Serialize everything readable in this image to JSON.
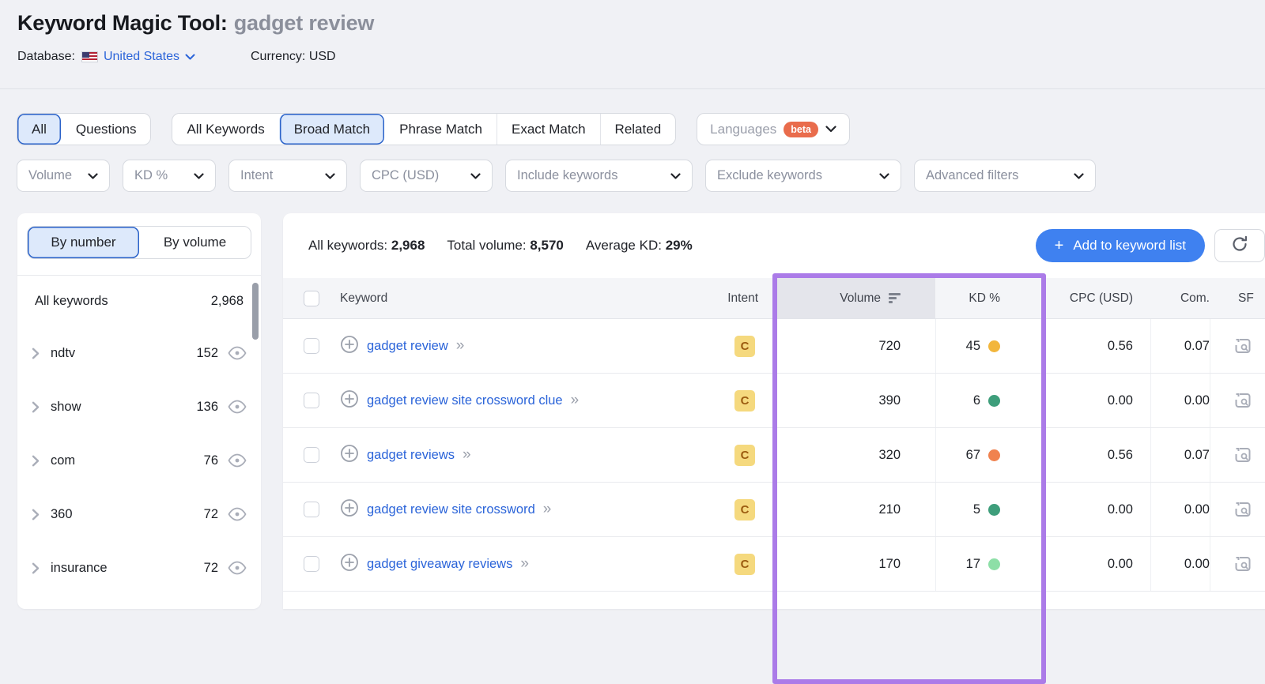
{
  "header": {
    "title": "Keyword Magic Tool:",
    "query": "gadget review",
    "database_label": "Database:",
    "database_value": "United States",
    "currency_label": "Currency:",
    "currency_value": "USD"
  },
  "tabs": {
    "group1": [
      {
        "label": "All",
        "selected": true
      },
      {
        "label": "Questions",
        "selected": false
      }
    ],
    "group2": [
      {
        "label": "All Keywords",
        "selected": false
      },
      {
        "label": "Broad Match",
        "selected": true
      },
      {
        "label": "Phrase Match",
        "selected": false
      },
      {
        "label": "Exact Match",
        "selected": false
      },
      {
        "label": "Related",
        "selected": false
      }
    ],
    "languages": {
      "label": "Languages",
      "badge": "beta"
    }
  },
  "filters": {
    "volume": "Volume",
    "kd": "KD %",
    "intent": "Intent",
    "cpc": "CPC (USD)",
    "include": "Include keywords",
    "exclude": "Exclude keywords",
    "advanced": "Advanced filters"
  },
  "sidebar": {
    "tabs": [
      {
        "label": "By number",
        "selected": true
      },
      {
        "label": "By volume",
        "selected": false
      }
    ],
    "all_keywords_label": "All keywords",
    "all_keywords_count": "2,968",
    "groups": [
      {
        "label": "ndtv",
        "count": "152"
      },
      {
        "label": "show",
        "count": "136"
      },
      {
        "label": "com",
        "count": "76"
      },
      {
        "label": "360",
        "count": "72"
      },
      {
        "label": "insurance",
        "count": "72"
      }
    ]
  },
  "summary": {
    "all_keywords_label": "All keywords:",
    "all_keywords_value": "2,968",
    "total_volume_label": "Total volume:",
    "total_volume_value": "8,570",
    "avg_kd_label": "Average KD:",
    "avg_kd_value": "29%",
    "add_button_label": "Add to keyword list",
    "add_button_plus": "+"
  },
  "table": {
    "columns": {
      "keyword": "Keyword",
      "intent": "Intent",
      "volume": "Volume",
      "kd": "KD %",
      "cpc": "CPC (USD)",
      "com": "Com.",
      "sf": "SF"
    },
    "rows": [
      {
        "keyword": "gadget review",
        "intent": "C",
        "volume": "720",
        "kd": "45",
        "kd_color": "#f2b63c",
        "cpc": "0.56",
        "com": "0.07"
      },
      {
        "keyword": "gadget review site crossword clue",
        "intent": "C",
        "volume": "390",
        "kd": "6",
        "kd_color": "#3e9e7b",
        "cpc": "0.00",
        "com": "0.00"
      },
      {
        "keyword": "gadget reviews",
        "intent": "C",
        "volume": "320",
        "kd": "67",
        "kd_color": "#f0824f",
        "cpc": "0.56",
        "com": "0.07"
      },
      {
        "keyword": "gadget review site crossword",
        "intent": "C",
        "volume": "210",
        "kd": "5",
        "kd_color": "#3e9e7b",
        "cpc": "0.00",
        "com": "0.00"
      },
      {
        "keyword": "gadget giveaway reviews",
        "intent": "C",
        "volume": "170",
        "kd": "17",
        "kd_color": "#8ddfa7",
        "cpc": "0.00",
        "com": "0.00"
      }
    ]
  },
  "colors": {
    "accent_blue": "#3f81f0",
    "link_blue": "#2b64d9",
    "selected_tab_bg": "#dde9fb",
    "selected_tab_border": "#2a62c9",
    "beta_badge": "#e96c4c",
    "intent_badge_bg": "#f5d97e",
    "intent_badge_text": "#9c5c10",
    "highlight_purple": "#ab7be8",
    "kd_easy": "#3e9e7b",
    "kd_light": "#8ddfa7",
    "kd_medium": "#f2b63c",
    "kd_hard": "#f0824f"
  }
}
